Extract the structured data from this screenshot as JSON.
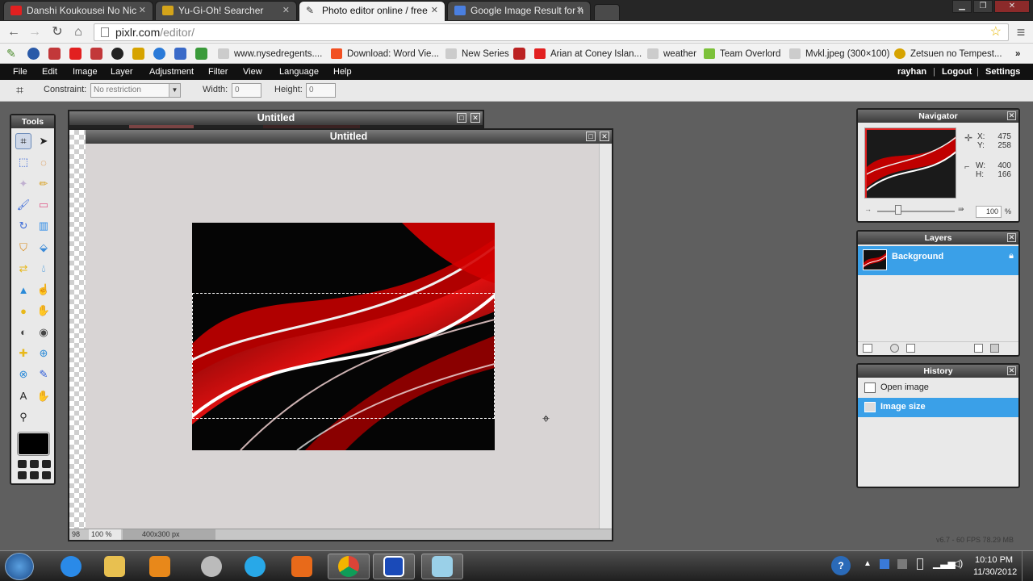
{
  "browser": {
    "tabs": [
      {
        "label": "Danshi Koukousei No Nic",
        "favicon_color": "#e22020"
      },
      {
        "label": "Yu-Gi-Oh! Searcher",
        "favicon_color": "#d4a41a"
      },
      {
        "label": "Photo editor online / free",
        "favicon_color": "#3a3a3a"
      },
      {
        "label": "Google Image Result for h",
        "favicon_color": "#4a7fe0"
      }
    ],
    "url_host": "pixlr.com",
    "url_path": "/editor/",
    "bookmarks": [
      {
        "label": "www.nysedregents....",
        "color": "#9a9a9a"
      },
      {
        "label": "Download: Word Vie...",
        "color": "#f25022"
      },
      {
        "label": "New Series",
        "color": "#bbbbbb"
      },
      {
        "label": "Arian at Coney Islan...",
        "color": "#e22020"
      },
      {
        "label": "weather",
        "color": "#bbbbbb"
      },
      {
        "label": "Team Overlord",
        "color": "#7cc13a"
      },
      {
        "label": "Mvkl.jpeg (300×100)",
        "color": "#bbbbbb"
      },
      {
        "label": "Zetsuen no Tempest...",
        "color": "#d6a300"
      }
    ]
  },
  "menu": {
    "items": [
      "File",
      "Edit",
      "Image",
      "Layer",
      "Adjustment",
      "Filter",
      "View",
      "Language",
      "Help"
    ],
    "user": "rayhan",
    "logout": "Logout",
    "settings": "Settings"
  },
  "options": {
    "constraint_label": "Constraint:",
    "constraint_value": "No restriction",
    "width_label": "Width:",
    "width_value": "0",
    "height_label": "Height:",
    "height_value": "0"
  },
  "tools": {
    "title": "Tools",
    "items": [
      "crop-icon",
      "move-icon",
      "marquee-icon",
      "lasso-icon",
      "wand-icon",
      "pencil-icon",
      "brush-icon",
      "eraser-icon",
      "replace-color-icon",
      "gradient-icon",
      "stamp-icon",
      "paint-bucket-icon",
      "color-replace-icon",
      "drop-icon",
      "sharpen-icon",
      "smudge-icon",
      "sponge-icon",
      "burn-icon",
      "dodge-icon",
      "red-eye-icon",
      "spot-heal-icon",
      "bloat-icon",
      "pinch-icon",
      "picker-icon",
      "type-icon",
      "hand-icon",
      "zoom-icon"
    ],
    "primary_color": "#000000"
  },
  "documents": [
    {
      "title": "Untitled"
    },
    {
      "title": "Untitled",
      "page_count": "98",
      "zoom": "100 %",
      "size": "400x300 px"
    }
  ],
  "navigator": {
    "title": "Navigator",
    "x_label": "X:",
    "x_value": "475",
    "y_label": "Y:",
    "y_value": "258",
    "w_label": "W:",
    "w_value": "400",
    "h_label": "H:",
    "h_value": "166",
    "zoom_value": "100",
    "zoom_unit": "%"
  },
  "layers": {
    "title": "Layers",
    "items": [
      {
        "name": "Background",
        "locked": true
      }
    ]
  },
  "history": {
    "title": "History",
    "items": [
      {
        "label": "Open image",
        "selected": false
      },
      {
        "label": "Image size",
        "selected": true
      }
    ]
  },
  "status_footer": "v6.7 - 60 FPS 78.29 MB",
  "taskbar": {
    "time": "10:10 PM",
    "date": "11/30/2012"
  },
  "colors": {
    "accent": "#3aa0e8",
    "menubar": "#111111",
    "workspace": "#5f5f5f"
  }
}
